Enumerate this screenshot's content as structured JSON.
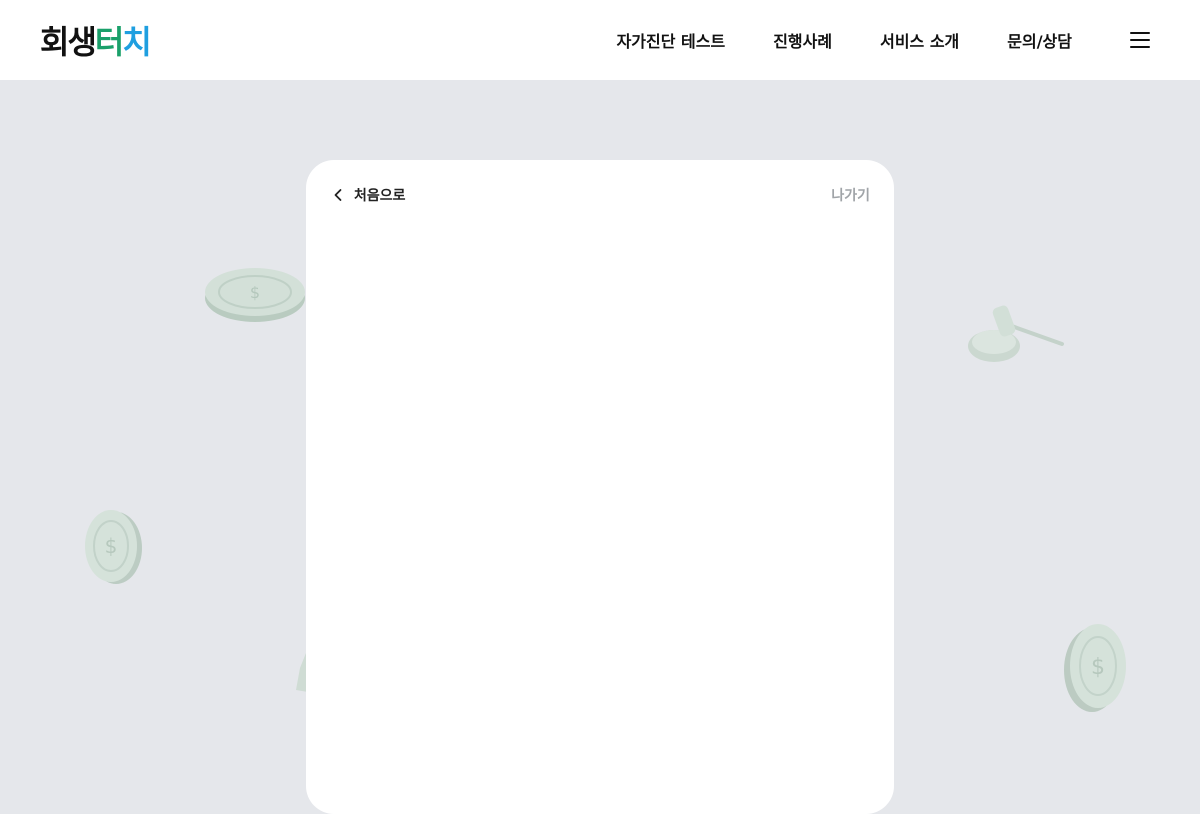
{
  "header": {
    "logo_part1": "회생",
    "logo_part2": "터",
    "logo_part3": "치",
    "nav": [
      {
        "label": "자가진단 테스트"
      },
      {
        "label": "진행사례"
      },
      {
        "label": "서비스 소개"
      },
      {
        "label": "문의/상담"
      }
    ],
    "menu_icon": "hamburger-menu-icon"
  },
  "card": {
    "back_label": "처음으로",
    "back_icon": "chevron-left-icon",
    "exit_label": "나가기"
  },
  "decorations": [
    "coin-icon",
    "gavel-icon",
    "coin-icon",
    "coin-icon"
  ],
  "colors": {
    "background": "#e5e7eb",
    "logo_green": "#1aa06a",
    "logo_blue": "#1f9fe0",
    "muted_text": "#a0a4a8",
    "deco_tint": "#cfdcd4"
  }
}
